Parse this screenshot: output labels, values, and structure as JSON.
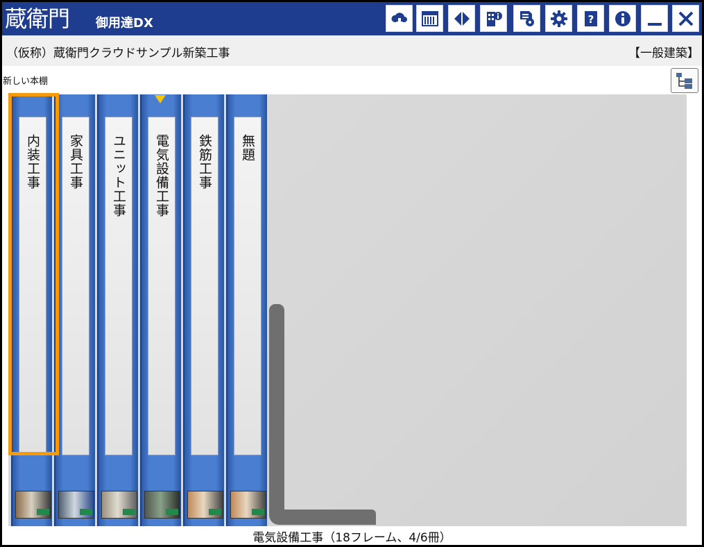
{
  "app": {
    "logo_text": "蔵衛門",
    "logo_sub": "御用達DX"
  },
  "toolbar": {
    "buttons": [
      {
        "name": "cloud-sync-button",
        "icon": "cloud-download-icon"
      },
      {
        "name": "bookshelf-view-button",
        "icon": "bookshelf-icon"
      },
      {
        "name": "compare-button",
        "icon": "left-right-arrows-icon"
      },
      {
        "name": "building-info-button",
        "icon": "building-info-icon"
      },
      {
        "name": "report-settings-button",
        "icon": "document-gear-icon"
      },
      {
        "name": "settings-button",
        "icon": "gear-icon"
      },
      {
        "name": "help-button",
        "icon": "question-book-icon"
      },
      {
        "name": "info-button",
        "icon": "info-icon"
      },
      {
        "name": "minimize-button",
        "icon": "minimize-icon"
      },
      {
        "name": "close-button",
        "icon": "close-icon"
      }
    ]
  },
  "project": {
    "name": "（仮称）蔵衛門クラウドサンプル新築工事",
    "category": "【一般建築】"
  },
  "shelf": {
    "name": "新しい本棚"
  },
  "binders": [
    {
      "title": "内装工事",
      "thumb_colors": [
        "#8c6c4a",
        "#d8d0c0",
        "#3a3a3a"
      ],
      "selected": true
    },
    {
      "title": "家具工事",
      "thumb_colors": [
        "#506070",
        "#d0d8e0",
        "#2a4a8a"
      ],
      "selected": false
    },
    {
      "title": "ユニット工事",
      "thumb_colors": [
        "#9a9080",
        "#e0dcd0",
        "#606060"
      ],
      "selected": false
    },
    {
      "title": "電気設備工事",
      "thumb_colors": [
        "#505850",
        "#88a088",
        "#2a302a"
      ],
      "selected": false
    },
    {
      "title": "鉄筋工事",
      "thumb_colors": [
        "#c08a5a",
        "#e8d8c0",
        "#444444"
      ],
      "selected": false
    },
    {
      "title": "無題",
      "thumb_colors": [
        "#c08a5a",
        "#e8d8c0",
        "#444444"
      ],
      "selected": false
    }
  ],
  "status": {
    "text": "電気設備工事（18フレーム、4/6冊）"
  },
  "colors": {
    "titlebar": "#1f3d8f",
    "binder": "#4a7ed1",
    "selection": "#f59a0c",
    "marker": "#f5c50c"
  }
}
